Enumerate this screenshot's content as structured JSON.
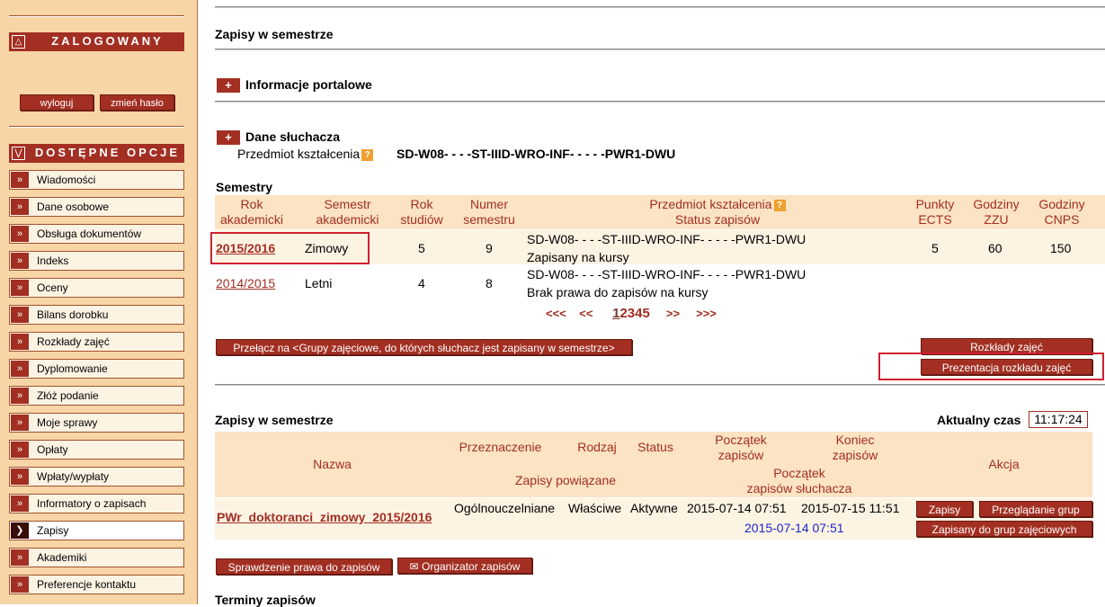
{
  "sidebar": {
    "logged_header": "ZALOGOWANY",
    "logout_label": "wyloguj",
    "change_password_label": "zmień hasło",
    "options_header": "DOSTĘPNE OPCJE",
    "menu": [
      {
        "label": "Wiadomości"
      },
      {
        "label": "Dane osobowe"
      },
      {
        "label": "Obsługa dokumentów"
      },
      {
        "label": "Indeks"
      },
      {
        "label": "Oceny"
      },
      {
        "label": "Bilans dorobku"
      },
      {
        "label": "Rozkłady zajęć"
      },
      {
        "label": "Dyplomowanie"
      },
      {
        "label": "Złóż podanie"
      },
      {
        "label": "Moje sprawy"
      },
      {
        "label": "Opłaty"
      },
      {
        "label": "Wpłaty/wypłaty"
      },
      {
        "label": "Informatory o zapisach"
      },
      {
        "label": "Zapisy",
        "active": true
      },
      {
        "label": "Akademiki"
      },
      {
        "label": "Preferencje kontaktu"
      }
    ]
  },
  "main": {
    "page_title": "Zapisy w semestrze",
    "portal_info": {
      "plus": "+",
      "label": "Informacje portalowe"
    },
    "student": {
      "plus": "+",
      "label": "Dane słuchacza",
      "subject_label": "Przedmiot kształcenia",
      "help": "?",
      "subject_value": "SD-W08- - - -ST-IIID-WRO-INF- - - - -PWR1-DWU"
    },
    "semesters": {
      "title": "Semestry",
      "headers": {
        "rok1": "Rok",
        "rok2": "akademicki",
        "sem1": "Semestr",
        "sem2": "akademicki",
        "studiow1": "Rok",
        "studiow2": "studiów",
        "num1": "Numer",
        "num2": "semestru",
        "subj1": "Przedmiot kształcenia",
        "subj_help": "?",
        "subj2": "Status zapisów",
        "ects1": "Punkty",
        "ects2": "ECTS",
        "zzu1": "Godziny",
        "zzu2": "ZZU",
        "cnps1": "Godziny",
        "cnps2": "CNPS"
      },
      "rows": [
        {
          "year": "2015/2016",
          "semester": "Zimowy",
          "study_year": "5",
          "number": "9",
          "subject": "SD-W08- - - -ST-IIID-WRO-INF- - - - -PWR1-DWU",
          "status": "Zapisany na kursy",
          "ects": "5",
          "zzu": "60",
          "cnps": "150"
        },
        {
          "year": "2014/2015",
          "semester": "Letni",
          "study_year": "4",
          "number": "8",
          "subject": "SD-W08- - - -ST-IIID-WRO-INF- - - - -PWR1-DWU",
          "status": "Brak prawa do zapisów na kursy",
          "ects": "",
          "zzu": "",
          "cnps": ""
        }
      ],
      "pager": {
        "first": "<<<",
        "prev": "<<",
        "pages": [
          "1",
          "2",
          "3",
          "4",
          "5"
        ],
        "next": ">>",
        "last": ">>>"
      }
    },
    "switch_button": "Przełącz na <Grupy zajęciowe, do których słuchacz jest zapisany w semestrze>",
    "schedules_button": "Rozkłady zajęć",
    "presentation_button": "Prezentacja rozkładu zajęć",
    "enrollments": {
      "title": "Zapisy w semestrze",
      "current_time_label": "Aktualny czas",
      "current_time": "11:17:24",
      "headers": {
        "nazwa": "Nazwa",
        "przeznaczenie": "Przeznaczenie",
        "rodzaj": "Rodzaj",
        "status": "Status",
        "poczatek1": "Początek",
        "poczatek2": "zapisów",
        "koniec1": "Koniec",
        "koniec2": "zapisów",
        "akcja": "Akcja",
        "powiazane": "Zapisy powiązane",
        "pocz_sl1": "Początek",
        "pocz_sl2": "zapisów słuchacza"
      },
      "row": {
        "name": "PWr_doktoranci_zimowy_2015/2016",
        "purpose": "Ogólnouczelniane",
        "kind": "Właściwe",
        "status": "Aktywne",
        "start": "2015-07-14 07:51",
        "end": "2015-07-15 11:51",
        "student_start": "2015-07-14 07:51",
        "btn_enroll": "Zapisy",
        "btn_browse": "Przeglądanie grup",
        "btn_enrolled": "Zapisany do grup zajęciowych"
      }
    },
    "check_rights_button": "Sprawdzenie prawa do zapisów",
    "organizer_button": "Organizator zapisów",
    "terms_title": "Terminy zapisów"
  }
}
